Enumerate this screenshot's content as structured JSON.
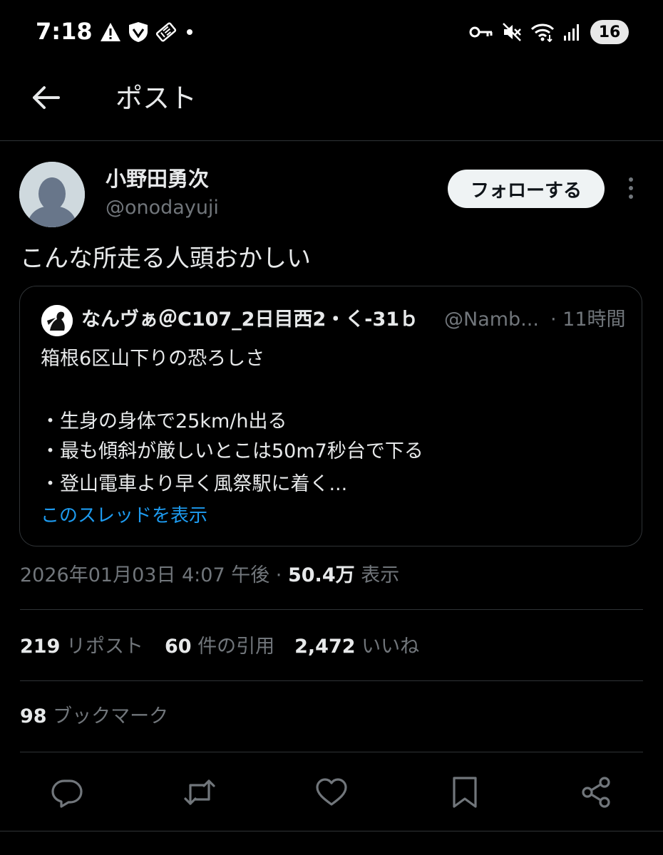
{
  "status_bar": {
    "time": "7:18",
    "battery": "16",
    "left_icons": [
      "warning-icon",
      "vpn-shield-icon",
      "ticket-icon",
      "dot-icon"
    ],
    "right_icons": [
      "key-icon",
      "mute-icon",
      "wifi-icon",
      "signal-icon"
    ]
  },
  "header": {
    "title": "ポスト"
  },
  "author": {
    "name": "小野田勇次",
    "handle": "@onodayuji",
    "follow_label": "フォローする"
  },
  "post": {
    "text": "こんな所走る人頭おかしい"
  },
  "quote": {
    "name": "なんヴぁ＠C107_2日目西2・く-31ｂ",
    "handle": "@Namb...",
    "time": "· 11時間",
    "lines": [
      "箱根6区山下りの恐ろしさ",
      "",
      "・生身の身体で25km/h出る",
      "・最も傾斜が厳しいとこは50m7秒台で下る",
      "・登山電車より早く風祭駅に着く..."
    ],
    "show_thread": "このスレッドを表示"
  },
  "meta": {
    "datetime": "2026年01月03日 4:07 午後 · ",
    "views_count": "50.4万",
    "views_label": " 表示"
  },
  "stats": {
    "reposts_count": "219",
    "reposts_label": " リポスト",
    "quotes_count": "60",
    "quotes_label": " 件の引用",
    "likes_count": "2,472",
    "likes_label": " いいね",
    "bookmarks_count": "98",
    "bookmarks_label": " ブックマーク"
  },
  "colors": {
    "background": "#000000",
    "text": "#e7e9ea",
    "secondary": "#71767b",
    "link": "#1d9bf0",
    "divider": "#2f3336"
  }
}
